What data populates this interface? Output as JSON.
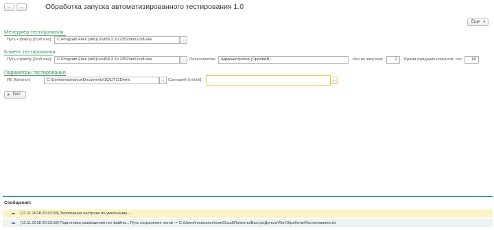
{
  "window": {
    "title": "Обработка запуска автоматизированного тестирования 1.0"
  },
  "nav": {
    "back_icon": "←",
    "forward_icon": "→"
  },
  "toolbar": {
    "more_label": "Еще",
    "more_arrow": "▾"
  },
  "manager": {
    "title": "Менеджер тестирования",
    "path_label": "Путь к файлу [1cv8.exe]:",
    "path_value": "C:\\Program Files (x86)\\1cv8\\8.3.10.2252\\bin\\1cv8.exe",
    "select_label": "..."
  },
  "client": {
    "title": "Клиент тестирования",
    "path_label": "Путь к файлу [1cv8.exe]:",
    "path_value": "C:\\Program Files (x86)\\1cv8\\8.3.10.2252\\bin\\1cv8.exe",
    "select_label": "...",
    "user_label": "Пользователь:",
    "user_value": "Администратор (ОрловАВ)",
    "runs_label": "Кол-во запусков:",
    "runs_value": "2",
    "wait_label": "Время ожидания клиентов, сек.:",
    "wait_value": "60"
  },
  "params": {
    "title": "Параметры тестирования",
    "ib_label": "ИБ [Каталог]:",
    "ib_value": "C:\\Users\\resonance\\Documents\\1C\\UT11Demo",
    "select_label": "...",
    "scenario_label": "Сценарий [xml,txt]:",
    "scenario_value": "",
    "scenario_select_label": "..."
  },
  "test_button": {
    "label": "Тест"
  },
  "messages": {
    "title": "Сообщения:",
    "items": [
      "[11.11.2018 20:32:58] Заполнение настроек по умолчанию....",
      "[11.11.2018 20:32:58] Подготовка размещения лог-файла... Путь сохранения логов -> C:\\Users\\resonance\\ownCloud\\Проекты\\БыстроДеньги\\ЛогОбработкиТестирования.txt"
    ]
  },
  "colors": {
    "group_title": "#3c9a5f",
    "highlight_border": "#e8c84a",
    "message_bar": "#4a90c8"
  }
}
